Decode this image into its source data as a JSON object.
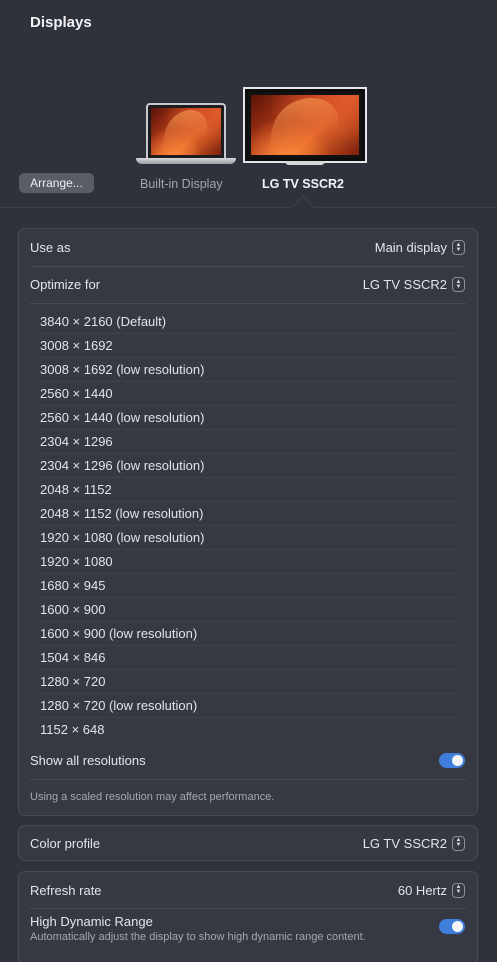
{
  "window": {
    "title": "Displays"
  },
  "arrange_button": "Arrange...",
  "displays": [
    {
      "name": "Built-in Display",
      "selected": false
    },
    {
      "name": "LG TV SSCR2",
      "selected": true
    }
  ],
  "settings": {
    "use_as": {
      "label": "Use as",
      "value": "Main display"
    },
    "optimize_for": {
      "label": "Optimize for",
      "value": "LG TV SSCR2"
    },
    "resolutions": [
      "3840 × 2160 (Default)",
      "3008 × 1692",
      "3008 × 1692 (low resolution)",
      "2560 × 1440",
      "2560 × 1440 (low resolution)",
      "2304 × 1296",
      "2304 × 1296 (low resolution)",
      "2048 × 1152",
      "2048 × 1152 (low resolution)",
      "1920 × 1080 (low resolution)",
      "1920 × 1080",
      "1680 × 945",
      "1600 × 900",
      "1600 × 900 (low resolution)",
      "1504 × 846",
      "1280 × 720",
      "1280 × 720 (low resolution)",
      "1152 × 648"
    ],
    "show_all_resolutions": {
      "label": "Show all resolutions",
      "enabled": true
    },
    "scaled_note": "Using a scaled resolution may affect performance.",
    "color_profile": {
      "label": "Color profile",
      "value": "LG TV SSCR2"
    },
    "refresh_rate": {
      "label": "Refresh rate",
      "value": "60 Hertz"
    },
    "hdr": {
      "label": "High Dynamic Range",
      "description": "Automatically adjust the display to show high dynamic range content.",
      "enabled": true
    }
  },
  "colors": {
    "accent": "#3f7fdb",
    "background": "#2f323a",
    "panel": "#363941"
  }
}
